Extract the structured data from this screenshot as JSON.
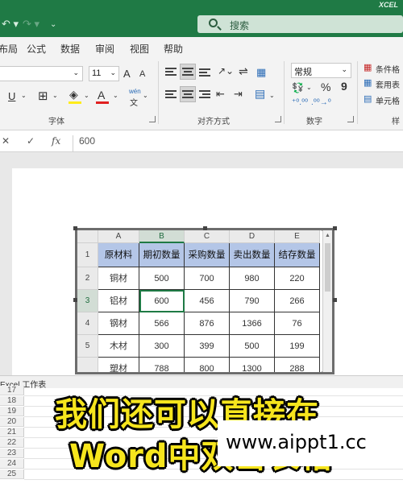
{
  "titlebar": {
    "search_placeholder": "搜索",
    "brand": "XCEL"
  },
  "tabs": [
    "布局",
    "公式",
    "数据",
    "审阅",
    "视图",
    "帮助"
  ],
  "ribbon": {
    "font_size": "11",
    "grow_font": "A",
    "shrink_font": "A",
    "underline": "U",
    "font_color": "A",
    "pinyin": "wén",
    "number_format": "常规",
    "percent": "%",
    "comma": "9",
    "styles": [
      "条件格",
      "套用表",
      "单元格"
    ],
    "groups": {
      "font": "字体",
      "align": "对齐方式",
      "number": "数字",
      "styles": "样"
    }
  },
  "formula_bar": {
    "cancel": "✕",
    "enter": "✓",
    "fx": "fx",
    "value": "600"
  },
  "spreadsheet": {
    "columns": [
      "A",
      "B",
      "C",
      "D",
      "E"
    ],
    "rows": [
      "1",
      "2",
      "3",
      "4",
      "5"
    ],
    "table": [
      [
        "原材料",
        "期初数量",
        "采购数量",
        "卖出数量",
        "结存数量"
      ],
      [
        "铜材",
        "500",
        "700",
        "980",
        "220"
      ],
      [
        "铝材",
        "600",
        "456",
        "790",
        "266"
      ],
      [
        "钢材",
        "566",
        "876",
        "1366",
        "76"
      ],
      [
        "木材",
        "300",
        "399",
        "500",
        "199"
      ],
      [
        "塑材",
        "788",
        "800",
        "1300",
        "288"
      ]
    ],
    "active_cell": "B3"
  },
  "sheet_tab": "Excel 工作表",
  "bottom_rows": [
    "17",
    "18",
    "19",
    "20",
    "21",
    "22",
    "23",
    "24",
    "25"
  ],
  "caption": {
    "line1": "我们还可以直接在",
    "line2": "Word中双击表格"
  },
  "watermark": "www.aippt1.cc",
  "colors": {
    "title_bar": "#1f7a45",
    "header_fill": "#b4c6e7",
    "caption": "#f6e51d"
  }
}
